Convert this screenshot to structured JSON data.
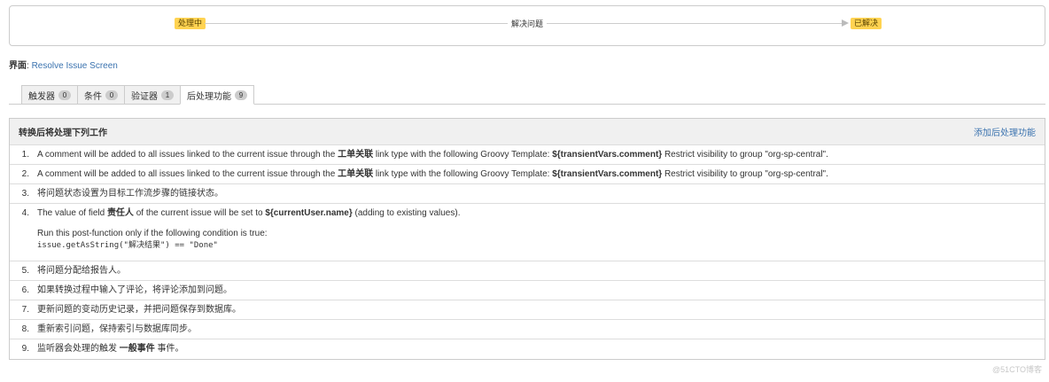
{
  "transition": {
    "from_status": "处理中",
    "name": "解决问题",
    "to_status": "已解决",
    "status_color": "#ffd351"
  },
  "screen": {
    "label": "界面",
    "separator": ":",
    "link": "Resolve Issue Screen"
  },
  "tabs": [
    {
      "label": "触发器",
      "count": "0"
    },
    {
      "label": "条件",
      "count": "0"
    },
    {
      "label": "验证器",
      "count": "1"
    },
    {
      "label": "后处理功能",
      "count": "9"
    }
  ],
  "panel": {
    "title": "转换后将处理下列工作",
    "action": "添加后处理功能"
  },
  "post_functions": {
    "r1": {
      "num": "1.",
      "a": "A comment will be added to all issues linked to the current issue through the ",
      "b1": "工单关联",
      "c": " link type with the following Groovy Template: ",
      "b2": "${transientVars.comment}",
      "d": " Restrict visibility to group \"org-sp-central\"."
    },
    "r2": {
      "num": "2.",
      "a": "A comment will be added to all issues linked to the current issue through the ",
      "b1": "工单关联",
      "c": " link type with the following Groovy Template: ",
      "b2": "${transientVars.comment}",
      "d": " Restrict visibility to group \"org-sp-central\"."
    },
    "r3": {
      "num": "3.",
      "text": "将问题状态设置为目标工作流步骤的链接状态。"
    },
    "r4": {
      "num": "4.",
      "a": "The value of field ",
      "b1": "责任人",
      "c": " of the current issue will be set to ",
      "b2": "${currentUser.name}",
      "d": " (adding to existing values).",
      "condition": "Run this post-function only if the following condition is true:",
      "code": "issue.getAsString(\"解决结果\") == \"Done\""
    },
    "r5": {
      "num": "5.",
      "text": "将问题分配给报告人。"
    },
    "r6": {
      "num": "6.",
      "text": "如果转换过程中输入了评论，将评论添加到问题。"
    },
    "r7": {
      "num": "7.",
      "text": "更新问题的变动历史记录，并把问题保存到数据库。"
    },
    "r8": {
      "num": "8.",
      "text": "重新索引问题，保持索引与数据库同步。"
    },
    "r9": {
      "num": "9.",
      "a": "监听器会处理的触发 ",
      "b1": "一般事件",
      "c": " 事件。"
    }
  },
  "watermark": "@51CTO博客"
}
